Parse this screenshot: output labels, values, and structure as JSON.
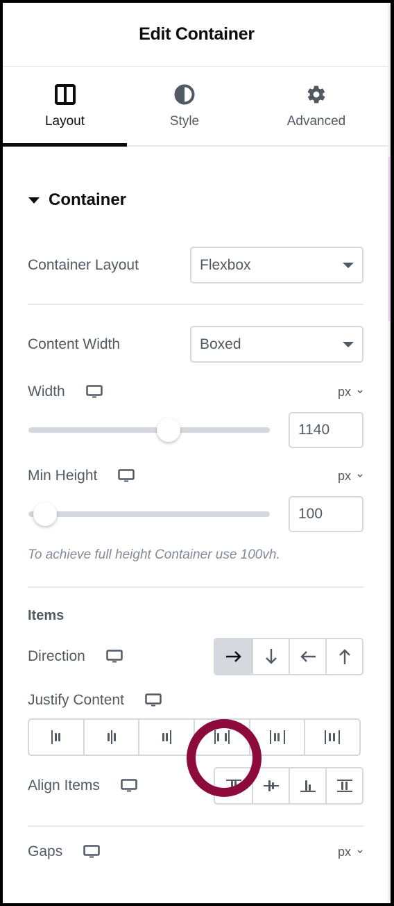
{
  "header": {
    "title": "Edit Container"
  },
  "tabs": [
    {
      "label": "Layout",
      "icon": "columns-icon",
      "active": true
    },
    {
      "label": "Style",
      "icon": "half-circle-icon",
      "active": false
    },
    {
      "label": "Advanced",
      "icon": "gear-icon",
      "active": false
    }
  ],
  "section": {
    "title": "Container",
    "container_layout": {
      "label": "Container Layout",
      "value": "Flexbox"
    },
    "content_width": {
      "label": "Content Width",
      "value": "Boxed"
    },
    "width": {
      "label": "Width",
      "unit": "px",
      "value": "1140",
      "slider_fraction": 0.58
    },
    "min_height": {
      "label": "Min Height",
      "unit": "px",
      "value": "100",
      "slider_fraction": 0.07
    },
    "hint": "To achieve full height Container use 100vh.",
    "items_heading": "Items",
    "direction": {
      "label": "Direction",
      "options": [
        {
          "name": "row",
          "glyph": "→",
          "active": true
        },
        {
          "name": "column",
          "glyph": "↓",
          "active": false
        },
        {
          "name": "row-reverse",
          "glyph": "←",
          "active": false
        },
        {
          "name": "column-reverse",
          "glyph": "↑",
          "active": false
        }
      ]
    },
    "justify_content": {
      "label": "Justify Content",
      "options": [
        "start",
        "center",
        "end",
        "space-between",
        "space-around",
        "space-evenly"
      ],
      "highlighted": "space-between"
    },
    "align_items": {
      "label": "Align Items",
      "options": [
        "start",
        "center",
        "end",
        "stretch"
      ]
    },
    "gaps": {
      "label": "Gaps",
      "unit": "px"
    }
  },
  "colors": {
    "accent_annotation": "#8c0a3c",
    "text_primary": "#0c0d0e",
    "text_secondary": "#515962",
    "border": "#d5d8dc"
  }
}
